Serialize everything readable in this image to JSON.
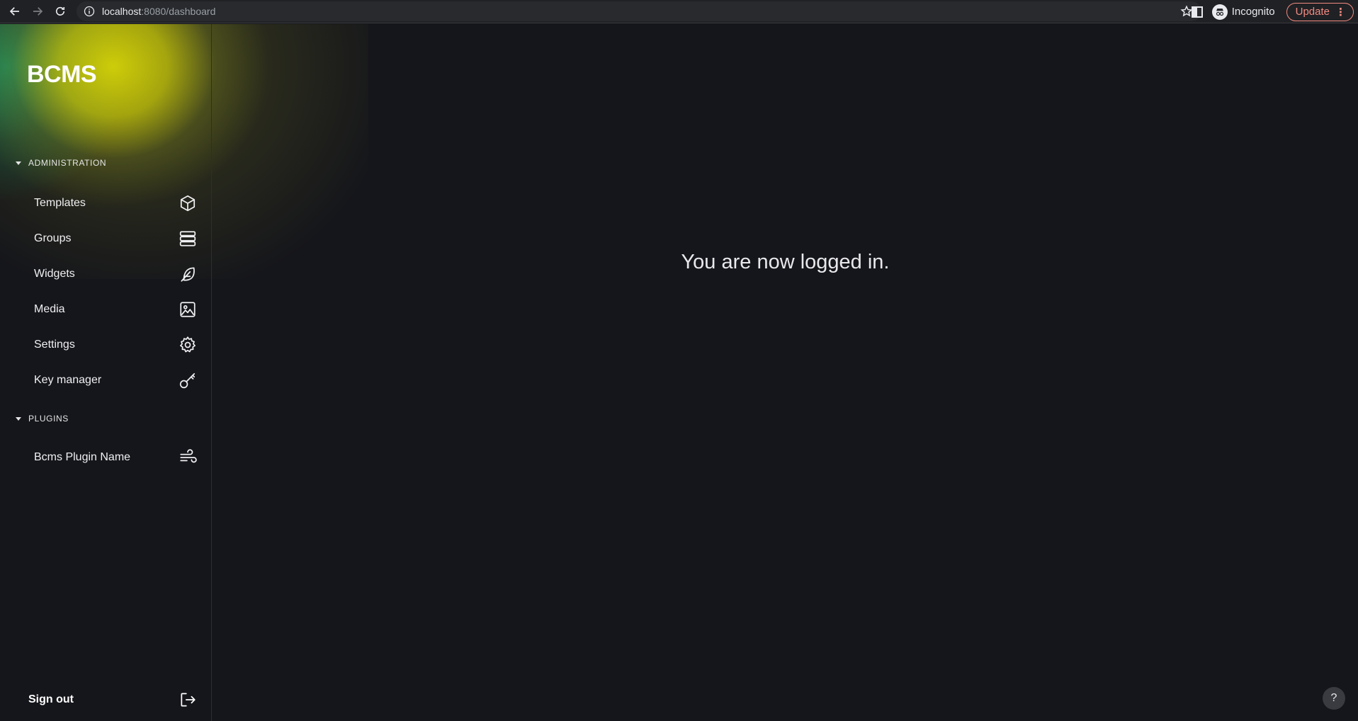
{
  "browser": {
    "url_host": "localhost",
    "url_path": ":8080/dashboard",
    "profile_label": "Incognito",
    "update_label": "Update"
  },
  "app": {
    "logo": "BCMS",
    "sections": [
      {
        "label": "ADMINISTRATION",
        "items": [
          {
            "label": "Templates",
            "icon": "cube-icon"
          },
          {
            "label": "Groups",
            "icon": "layers-icon"
          },
          {
            "label": "Widgets",
            "icon": "feather-icon"
          },
          {
            "label": "Media",
            "icon": "image-icon"
          },
          {
            "label": "Settings",
            "icon": "gear-icon"
          },
          {
            "label": "Key manager",
            "icon": "key-icon"
          }
        ]
      },
      {
        "label": "PLUGINS",
        "items": [
          {
            "label": "Bcms Plugin Name",
            "icon": "wind-icon"
          }
        ]
      }
    ],
    "sign_out_label": "Sign out",
    "main_message": "You are now logged in.",
    "help_label": "?"
  }
}
